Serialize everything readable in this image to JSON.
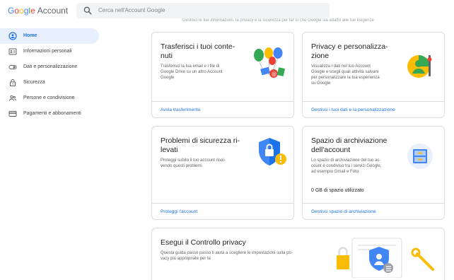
{
  "header": {
    "logo_letters": [
      "G",
      "o",
      "o",
      "g",
      "l",
      "e"
    ],
    "logo_suffix": "Account",
    "search_placeholder": "Cerca nell'Account Google",
    "strip_text": "Gestisci le tue informazioni, la privacy e la sicurezza per far sì che Google sia adatto alle tue esigenze"
  },
  "sidebar": {
    "items": [
      {
        "label": "Home",
        "icon": "home-icon",
        "active": true
      },
      {
        "label": "Informazioni personali",
        "icon": "id-card-icon",
        "active": false
      },
      {
        "label": "Dati e personalizzazione",
        "icon": "toggle-icon",
        "active": false
      },
      {
        "label": "Sicurezza",
        "icon": "lock-icon",
        "active": false
      },
      {
        "label": "Persone e condivisione",
        "icon": "people-icon",
        "active": false
      },
      {
        "label": "Pagamenti e abbonamenti",
        "icon": "credit-card-icon",
        "active": false
      }
    ]
  },
  "cards": {
    "transfer": {
      "title_1": "Trasferisci i tuoi conte-",
      "title_2": "nuti",
      "desc_1": "Trasferisci la tua email e i file di",
      "desc_2": "Google Drive su un altro Account",
      "desc_3": "Google",
      "link": "Avvia trasferimento"
    },
    "privacy": {
      "title_1": "Privacy e personalizza-",
      "title_2": "zione",
      "desc_1": "Visualizza i dati nel tuo Account",
      "desc_2": "Google e scegli quali attività salvare",
      "desc_3": "per personalizzare la tua esperienza",
      "desc_4": "su Google",
      "link": "Gestisci i tuoi dati e la personalizzazione"
    },
    "security": {
      "title_1": "Problemi di sicurezza ri-",
      "title_2": "levati",
      "desc_1": "Proteggi subito il tuo account risol-",
      "desc_2": "vendo questi problemi",
      "link": "Proteggi l'account"
    },
    "storage": {
      "title_1": "Spazio di archiviazione",
      "title_2": "dell'account",
      "desc_1": "Lo spazio di archiviazione del tuo ac-",
      "desc_2": "count è condiviso tra i servizi Google,",
      "desc_3": "ad esempio Gmail e Foto",
      "usage": "0 GB di spazio utilizzato",
      "link": "Gestisci spazio di archiviazione"
    },
    "checkup": {
      "title": "Esegui il Controllo privacy",
      "desc_1": "Questa guida passo passo ti aiuta a scegliere le impostazioni sulla pri-",
      "desc_2": "vacy più appropriate per te"
    }
  },
  "colors": {
    "blue": "#4285f4",
    "red": "#ea4335",
    "yellow": "#fbbc05",
    "green": "#34a853",
    "link": "#1a73e8",
    "active_bg": "#e8f0fe"
  }
}
